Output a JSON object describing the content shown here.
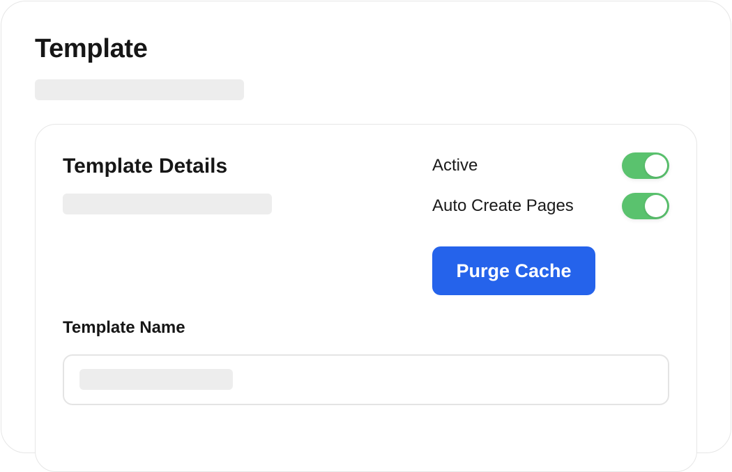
{
  "page": {
    "title": "Template"
  },
  "details": {
    "title": "Template Details",
    "toggles": [
      {
        "label": "Active",
        "on": true
      },
      {
        "label": "Auto Create Pages",
        "on": true
      }
    ],
    "purge_button_label": "Purge Cache"
  },
  "form": {
    "template_name_label": "Template Name",
    "template_name_value": ""
  },
  "colors": {
    "accent": "#2563eb",
    "toggle_on": "#5ac26e",
    "skeleton": "#ededed"
  }
}
